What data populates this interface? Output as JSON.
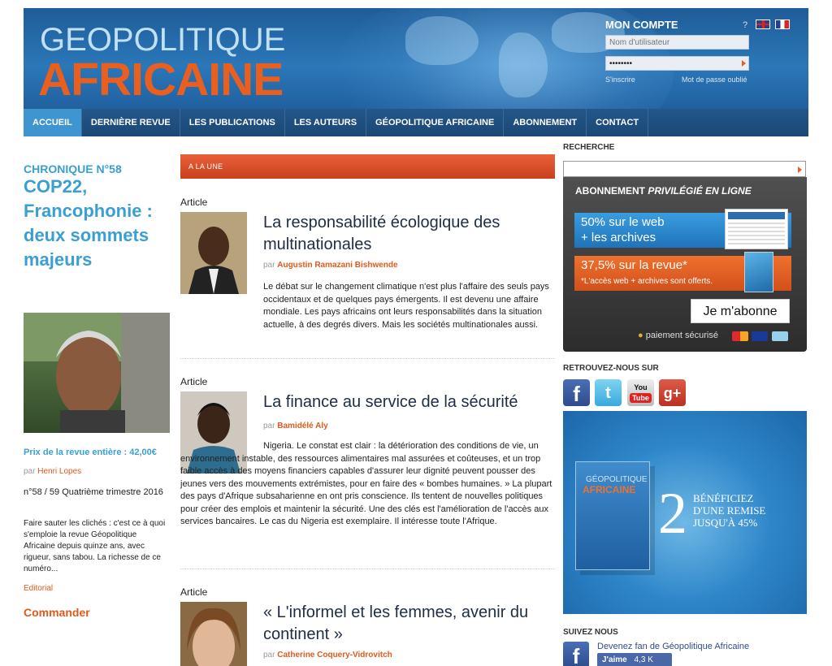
{
  "header": {
    "logo_line1": "GEOPOLITIQUE",
    "logo_line2": "AFRICAINE",
    "account_title": "MON COMPTE",
    "help": "?",
    "username_placeholder": "Nom d'utilisateur",
    "password_value": "••••••••",
    "signup": "S'inscrire",
    "forgot": "Mot de passe oublié",
    "brand_blue": "#2b77b8",
    "brand_orange": "#e95f1f"
  },
  "nav": [
    {
      "label": "ACCUEIL",
      "active": true
    },
    {
      "label": "DERNIÈRE REVUE",
      "active": false
    },
    {
      "label": "LES PUBLICATIONS",
      "active": false
    },
    {
      "label": "LES AUTEURS",
      "active": false
    },
    {
      "label": "GÉOPOLITIQUE AFRICAINE",
      "active": false
    },
    {
      "label": "ABONNEMENT",
      "active": false
    },
    {
      "label": "CONTACT",
      "active": false
    }
  ],
  "chronique": {
    "label": "CHRONIQUE N°58",
    "title": "COP22, Francophonie : deux sommets majeurs",
    "price": "Prix de la revue entière : 42,00€",
    "by": "par",
    "author": "Henri Lopes",
    "issue": "n°58 / 59 Quatrième trimestre 2016",
    "summary": "Faire sauter les clichés : c'est ce à quoi s'emploie la revue Géopolitique Africaine depuis quinze ans, avec rigueur, sans tabou. La richesse de ce numéro...",
    "category": "Editorial",
    "order": "Commander"
  },
  "une": {
    "label": "A LA UNE"
  },
  "articles": [
    {
      "label": "Article",
      "title": "La responsabilité écologique des multinationales",
      "by": "par",
      "author": "Augustin Ramazani Bishwende",
      "body": "Le débat sur le changement climatique n'est plus l'affaire des seuls pays occidentaux et de quelques pays émergents. Il est devenu une affaire mondiale. Les pays africains ont leurs responsabilités dans la situation actuelle, à des degrés divers. Mais les sociétés multinationales  aussi."
    },
    {
      "label": "Article",
      "title": "La finance au service de la sécurité",
      "by": "par",
      "author": "Bamidélé Aly",
      "body": "Nigeria. Le constat est clair : la détérioration des conditions de vie, un environnement instable, des ressources alimentaires mal assurées et coûteuses, et un trop faible accès à des moyens financiers capables d'assurer leur dignité peuvent pousser des jeunes vers des mouvements extrémistes, pour en faire des « bombes humaines. » La plupart des pays d'Afrique subsaharienne en ont pris conscience. Ils tentent de nouvelles politiques pour créer des emplois et  maintenir la  sécurité. Une des clés  est l'amélioration de l'accès aux services bancaires. Le cas du Nigeria est exemplaire. Il intéresse toute l'Afrique."
    },
    {
      "label": "Article",
      "title": "« L'informel et les femmes, avenir du continent »",
      "by": "par",
      "author": "Catherine Coquery-Vidrovitch",
      "body": ""
    }
  ],
  "sidebar": {
    "search_title": "RECHERCHE",
    "abo_title_a": "ABONNEMENT ",
    "abo_title_b": "PRIVILÉGIÉ EN LIGNE",
    "offer1_line1": "50% sur le web",
    "offer1_line2": "+ les archives",
    "offer2_line1": "37,5% sur la revue*",
    "offer2_line2": "*L'accès web + archives sont offerts.",
    "subscribe": "Je m'abonne",
    "secure": "paiement sécurisé",
    "follow_title": "RETROUVEZ-NOUS SUR",
    "promo_mag_line1": "GÉOPOLITIQUE",
    "promo_mag_line2": "AFRICAINE",
    "promo_number": "2",
    "promo_text": [
      "BÉNÉFICIEZ",
      "D'UNE REMISE",
      "JUSQU'À 45%"
    ],
    "suivez_title": "SUIVEZ NOUS",
    "fan_text": "Devenez fan de Géopolitique Africaine",
    "like_text": "J'aime",
    "like_count": "4,3 K"
  },
  "icons": {
    "facebook": "facebook-icon",
    "twitter": "twitter-icon",
    "youtube": "youtube-icon",
    "googleplus": "google-plus-icon",
    "lock": "lock-icon"
  }
}
